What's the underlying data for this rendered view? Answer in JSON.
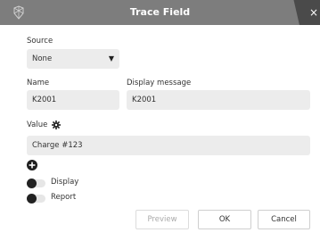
{
  "window": {
    "title": "Trace Field",
    "close_glyph": "×"
  },
  "source": {
    "label": "Source",
    "selected": "None",
    "chevron_icon": "chevron-down-icon"
  },
  "name": {
    "label": "Name",
    "value": "K2001"
  },
  "display_message": {
    "label": "Display message",
    "value": "K2001"
  },
  "value": {
    "label": "Value",
    "value": "Charge #123",
    "gear_icon": "gear-icon"
  },
  "add_icon": "plus-circle-icon",
  "toggles": [
    {
      "label": "Display",
      "on": false
    },
    {
      "label": "Report",
      "on": false
    }
  ],
  "buttons": {
    "preview": "Preview",
    "ok": "OK",
    "cancel": "Cancel"
  },
  "colors": {
    "titlebar": "#7d7d7d",
    "close_tab": "#4a4a4a",
    "field_bg": "#ececec"
  }
}
